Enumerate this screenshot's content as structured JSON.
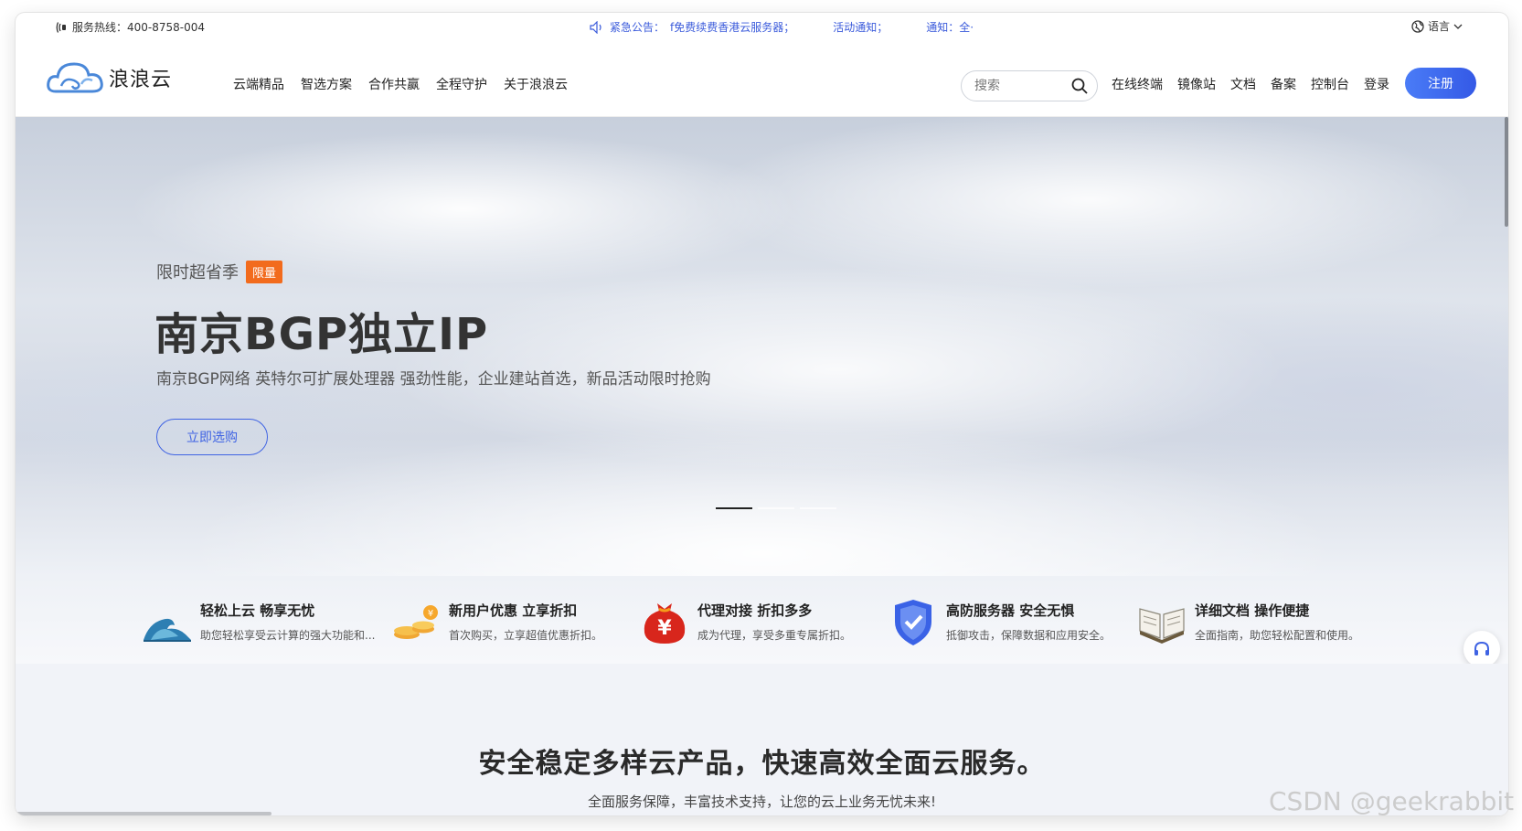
{
  "topbar": {
    "hotline": "服务热线：400-8758-004",
    "notice_label": "紧急公告：",
    "notice_text": "f免费续费香港云服务器；",
    "activity": "活动通知；",
    "notify": "通知：全·",
    "language": "语言"
  },
  "header": {
    "logo_text": "浪浪云",
    "nav": [
      "云端精品",
      "智选方案",
      "合作共赢",
      "全程守护",
      "关于浪浪云"
    ],
    "search_placeholder": "搜索",
    "right_nav": [
      "在线终端",
      "镜像站",
      "文档",
      "备案",
      "控制台",
      "登录"
    ],
    "register": "注册"
  },
  "hero": {
    "tag": "限时超省季",
    "badge": "限量",
    "title": "南京BGP独立IP",
    "subtitle": "南京BGP网络 英特尔可扩展处理器 强劲性能，企业建站首选，新品活动限时抢购",
    "button": "立即选购"
  },
  "features": [
    {
      "icon": "wave-icon",
      "title": "轻松上云 畅享无忧",
      "desc": "助您轻松享受云计算的强大功能和..."
    },
    {
      "icon": "coins-icon",
      "title": "新用户优惠 立享折扣",
      "desc": "首次购买，立享超值优惠折扣。"
    },
    {
      "icon": "money-bag-icon",
      "title": "代理对接 折扣多多",
      "desc": "成为代理，享受多重专属折扣。"
    },
    {
      "icon": "shield-icon",
      "title": "高防服务器 安全无惧",
      "desc": "抵御攻击，保障数据和应用安全。"
    },
    {
      "icon": "book-icon",
      "title": "详细文档 操作便捷",
      "desc": "全面指南，助您轻松配置和使用。"
    }
  ],
  "section": {
    "title": "安全稳定多样云产品，快速高效全面云服务。",
    "subtitle": "全面服务保障，丰富技术支持，让您的云上业务无忧未来!"
  },
  "watermark": "CSDN @geekrabbit",
  "colors": {
    "accent": "#3f63e3",
    "badge": "#f26b1d"
  }
}
